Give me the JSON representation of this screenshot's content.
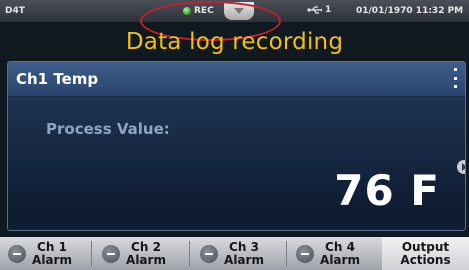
{
  "status_bar": {
    "device_name": "D4T",
    "rec_label": "REC",
    "usb_count": "1",
    "datetime": "01/01/1970 11:32 PM"
  },
  "caption": "Data log recording",
  "panel": {
    "channel_title": "Ch1 Temp",
    "process_label": "Process Value:",
    "process_value": "76 F"
  },
  "softkeys": [
    {
      "line1": "Ch 1",
      "line2": "Alarm"
    },
    {
      "line1": "Ch 2",
      "line2": "Alarm"
    },
    {
      "line1": "Ch 3",
      "line2": "Alarm"
    },
    {
      "line1": "Ch 4",
      "line2": "Alarm"
    }
  ],
  "output_actions": {
    "line1": "Output",
    "line2": "Actions"
  },
  "colors": {
    "caption": "#f2bf13",
    "rec_highlight": "#c8202a",
    "rec_dot": "#3fae2c"
  }
}
